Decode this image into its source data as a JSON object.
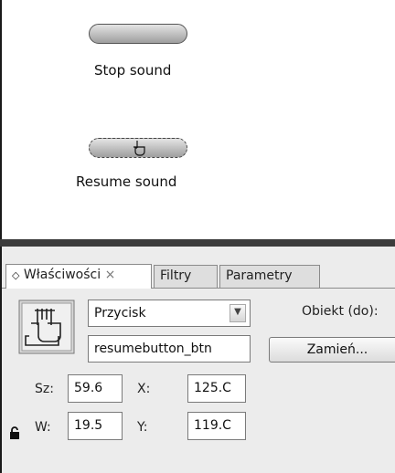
{
  "stage": {
    "stop_button_label": "Stop sound",
    "resume_button_label": "Resume sound"
  },
  "panel": {
    "tabs": [
      {
        "label": "Właściwości",
        "close": "×",
        "active": true
      },
      {
        "label": "Filtry",
        "active": false
      },
      {
        "label": "Parametry",
        "active": false
      }
    ],
    "symbol_type": "Przycisk",
    "instance_name": "resumebutton_btn",
    "object_label": "Obiekt (do):",
    "swap_button": "Zamień...",
    "width_label": "Sz:",
    "width_value": "59.6",
    "height_label": "W:",
    "height_value": "19.5",
    "x_label": "X:",
    "x_value": "125.C",
    "y_label": "Y:",
    "y_value": "119.C"
  },
  "icons": [
    "tab-collapse-icon",
    "button-symbol-icon",
    "dropdown-arrow-icon",
    "lock-icon",
    "hand-cursor-icon"
  ]
}
